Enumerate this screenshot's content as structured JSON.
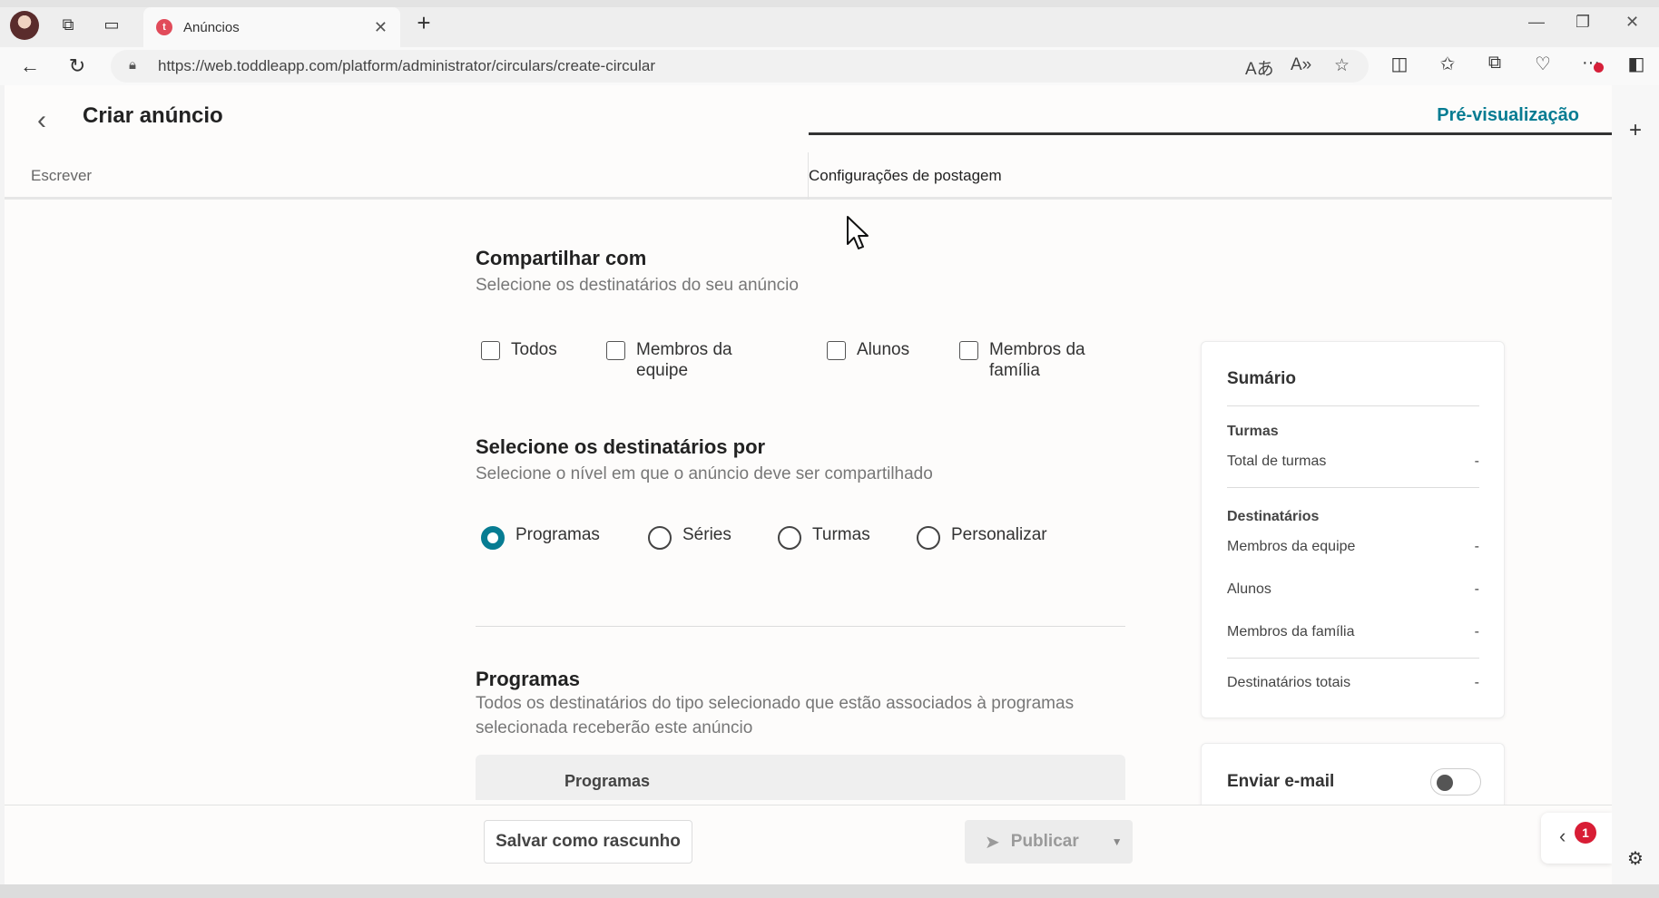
{
  "browser": {
    "tab_title": "Anúncios",
    "favicon_letter": "t",
    "url": "https://web.toddleapp.com/platform/administrator/circulars/create-circular",
    "notification_dot_color": "#d6203a"
  },
  "header": {
    "title": "Criar anúncio",
    "preview_label": "Pré-visualização"
  },
  "tabs": {
    "write": "Escrever",
    "settings": "Configurações de postagem"
  },
  "share": {
    "title": "Compartilhar com",
    "subtitle": "Selecione os destinatários do seu anúncio",
    "options": [
      {
        "label": "Todos",
        "checked": false
      },
      {
        "label": "Membros da equipe",
        "checked": false
      },
      {
        "label": "Alunos",
        "checked": false
      },
      {
        "label": "Membros da família",
        "checked": false
      }
    ]
  },
  "level": {
    "title": "Selecione os destinatários por",
    "subtitle": "Selecione o nível em que o anúncio deve ser compartilhado",
    "options": [
      {
        "label": "Programas",
        "selected": true
      },
      {
        "label": "Séries",
        "selected": false
      },
      {
        "label": "Turmas",
        "selected": false
      },
      {
        "label": "Personalizar",
        "selected": false
      }
    ]
  },
  "programs": {
    "title": "Programas",
    "subtitle": "Todos os destinatários do tipo selecionado que estão associados à programas selecionada receberão este anúncio",
    "table_header": "Programas"
  },
  "summary": {
    "title": "Sumário",
    "classes_section": "Turmas",
    "total_classes_label": "Total de turmas",
    "total_classes_value": "-",
    "recipients_section": "Destinatários",
    "rows": [
      {
        "label": "Membros da equipe",
        "value": "-"
      },
      {
        "label": "Alunos",
        "value": "-"
      },
      {
        "label": "Membros da família",
        "value": "-"
      }
    ],
    "total_label": "Destinatários totais",
    "total_value": "-"
  },
  "email": {
    "label": "Enviar e-mail",
    "enabled": false
  },
  "footer": {
    "draft_label": "Salvar como rascunho",
    "publish_label": "Publicar",
    "chat_badge": "1"
  },
  "colors": {
    "accent": "#077c92",
    "badge": "#d81d35"
  }
}
